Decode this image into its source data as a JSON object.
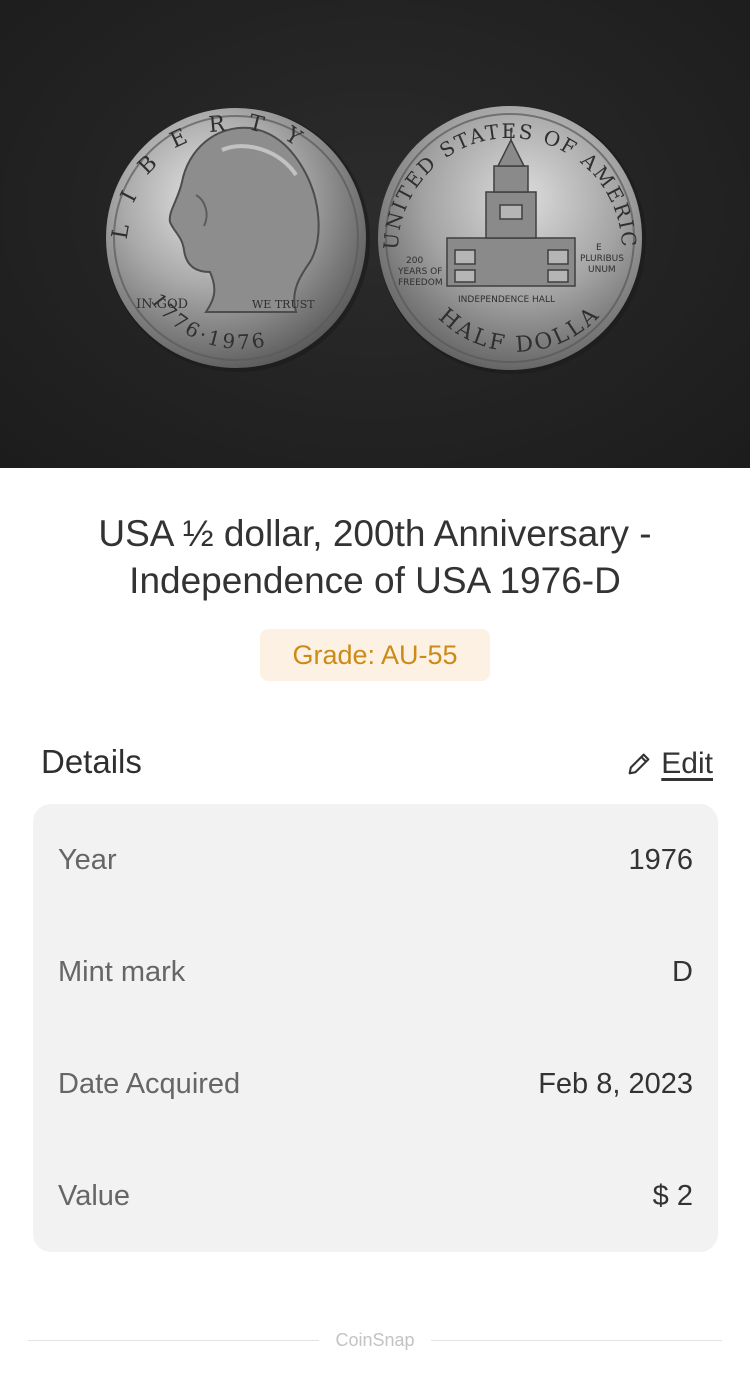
{
  "coin_photo": {
    "obverse": {
      "legend": "LIBERTY",
      "motto_left": "IN GOD",
      "motto_right": "WE TRUST",
      "dates": "1776·1976"
    },
    "reverse": {
      "legend": "UNITED STATES OF AMERICA",
      "denomination": "HALF DOLLAR",
      "building_label": "INDEPENDENCE HALL",
      "left_text": [
        "200",
        "YEARS OF",
        "FREEDOM"
      ],
      "right_text": [
        "E",
        "PLURIBUS",
        "UNUM"
      ]
    }
  },
  "coin": {
    "title": "USA ½ dollar, 200th Anniversary - Independence of USA 1976-D",
    "grade": "Grade: AU-55"
  },
  "details": {
    "heading": "Details",
    "edit_label": "Edit",
    "rows": [
      {
        "label": "Year",
        "value": "1976"
      },
      {
        "label": "Mint mark",
        "value": "D"
      },
      {
        "label": "Date Acquired",
        "value": "Feb 8, 2023"
      },
      {
        "label": "Value",
        "value": "$ 2"
      }
    ]
  },
  "footer": {
    "brand": "CoinSnap"
  },
  "colors": {
    "grade_text": "#cc8a17",
    "grade_bg": "#fdf1e3",
    "card_bg": "#f2f2f2",
    "photo_bg": "#232323"
  }
}
